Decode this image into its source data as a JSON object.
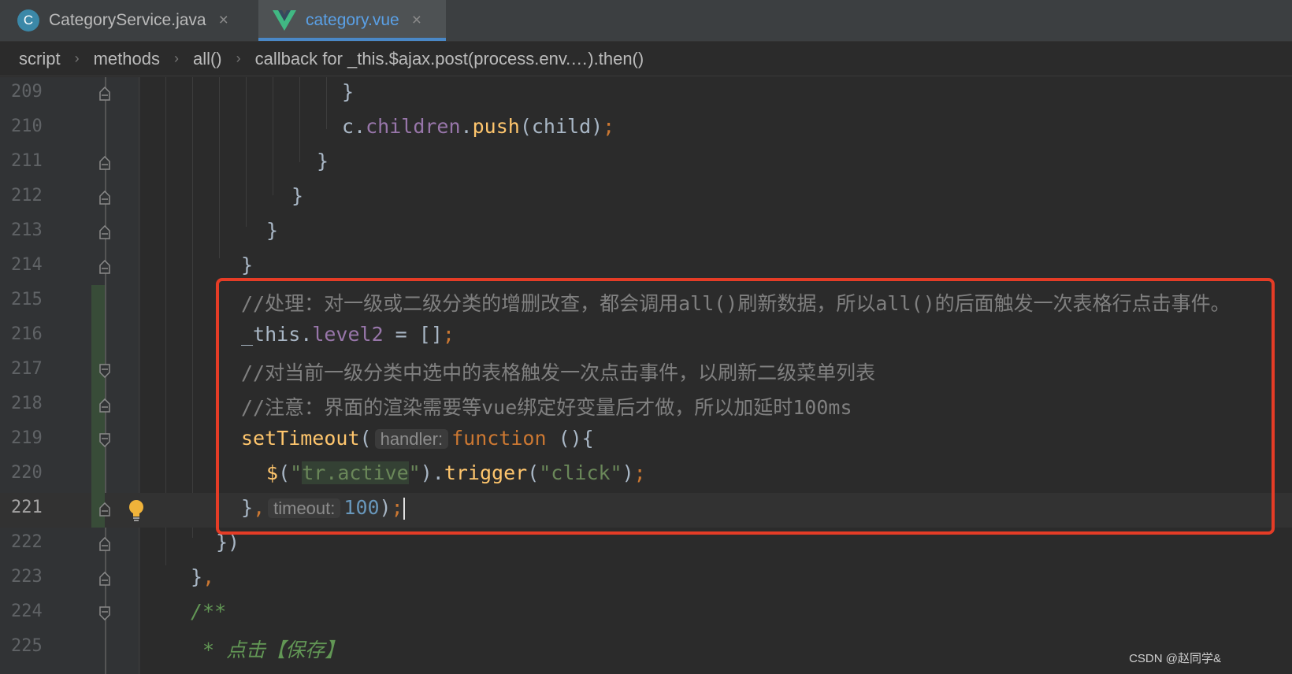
{
  "tabs": [
    {
      "label": "CategoryService.java",
      "icon": "java-class-icon",
      "active": false
    },
    {
      "label": "category.vue",
      "icon": "vue-logo-icon",
      "active": true
    }
  ],
  "close_glyph": "×",
  "breadcrumb": [
    "script",
    "methods",
    "all()",
    "callback for _this.$ajax.post(process.env.…).then()"
  ],
  "breadcrumb_sep": "›",
  "lines": [
    {
      "n": "209"
    },
    {
      "n": "210"
    },
    {
      "n": "211"
    },
    {
      "n": "212"
    },
    {
      "n": "213"
    },
    {
      "n": "214"
    },
    {
      "n": "215"
    },
    {
      "n": "216"
    },
    {
      "n": "217"
    },
    {
      "n": "218"
    },
    {
      "n": "219"
    },
    {
      "n": "220"
    },
    {
      "n": "221"
    },
    {
      "n": "222"
    },
    {
      "n": "223"
    },
    {
      "n": "224"
    },
    {
      "n": "225"
    }
  ],
  "code": {
    "l209": "}",
    "l210_a": "c.",
    "l210_b": "children",
    "l210_c": ".",
    "l210_d": "push",
    "l210_e": "(child)",
    "l210_f": ";",
    "l211": "}",
    "l212": "}",
    "l213": "}",
    "l214": "}",
    "l215": "//处理：对一级或二级分类的增删改查，都会调用all()刷新数据，所以all()的后面触发一次表格行点击事件。",
    "l216_a": "_this.",
    "l216_b": "level2",
    "l216_c": " = []",
    "l216_d": ";",
    "l217": "//对当前一级分类中选中的表格触发一次点击事件，以刷新二级菜单列表",
    "l218": "//注意：界面的渲染需要等vue绑定好变量后才做，所以加延时100ms",
    "l219_a": "setTimeout",
    "l219_b": "(",
    "l219_hint": "handler:",
    "l219_c": "function",
    "l219_d": " (){",
    "l220_a": "$",
    "l220_b": "(",
    "l220_c": "\"",
    "l220_d": "tr.active",
    "l220_e": "\"",
    "l220_f": ").",
    "l220_g": "trigger",
    "l220_h": "(",
    "l220_i": "\"click\"",
    "l220_j": ")",
    "l220_k": ";",
    "l221_a": "}",
    "l221_b": ",",
    "l221_hint": "timeout:",
    "l221_c": "100",
    "l221_d": ")",
    "l221_e": ";",
    "l222": "})",
    "l223_a": "}",
    "l223_b": ",",
    "l224": "/**",
    "l225": " * 点击【保存】"
  },
  "watermark": "CSDN @赵同学&",
  "colors": {
    "highlight_box": "#e53c26",
    "vue_green": "#41b883",
    "java_badge": "#3b88a8"
  }
}
